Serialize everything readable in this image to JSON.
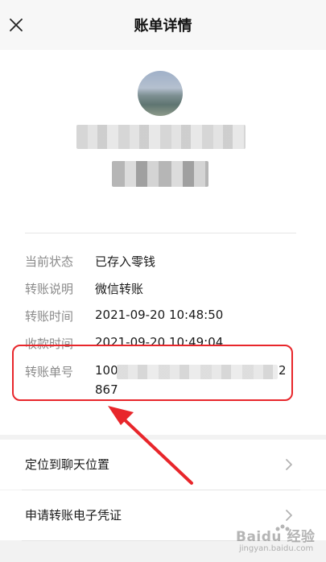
{
  "header": {
    "title": "账单详情",
    "close_icon": "close-icon"
  },
  "details": {
    "status_label": "当前状态",
    "status_value": "已存入零钱",
    "note_label": "转账说明",
    "note_value": "微信转账",
    "transfer_time_label": "转账时间",
    "transfer_time_value": "2021-09-20 10:48:50",
    "receive_time_label": "收款时间",
    "receive_time_value": "2021-09-20 10:49:04",
    "order_label": "转账单号",
    "order_value_prefix": "100",
    "order_value_suffix": "2",
    "order_value_line2": "867"
  },
  "menu": {
    "locate_label": "定位到聊天位置",
    "voucher_label": "申请转账电子凭证"
  },
  "watermark": {
    "main": "Baidu 经验",
    "sub": "jingyan.baidu.com"
  },
  "colors": {
    "highlight": "#e8262b",
    "background": "#f2f2f2"
  }
}
